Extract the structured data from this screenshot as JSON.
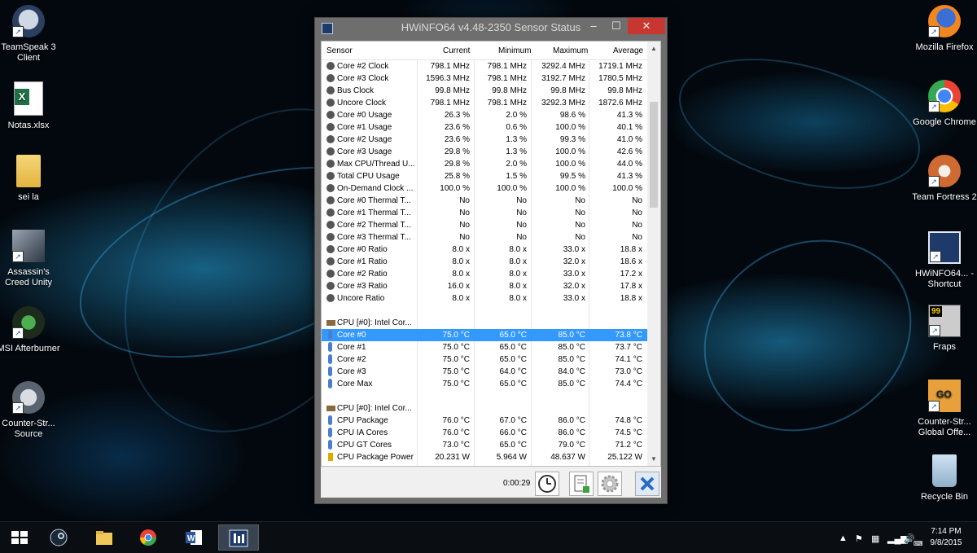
{
  "desktop": {
    "left_icons": [
      {
        "label": "TeamSpeak 3 Client",
        "icon": "teamspeak-icon"
      },
      {
        "label": "Notas.xlsx",
        "icon": "excel-file-icon"
      },
      {
        "label": "sei la",
        "icon": "folder-icon"
      },
      {
        "label": "Assassin's Creed Unity",
        "icon": "assassins-creed-icon"
      },
      {
        "label": "MSI Afterburner",
        "icon": "msi-afterburner-icon"
      },
      {
        "label": "Counter-Str... Source",
        "icon": "counter-strike-source-icon"
      }
    ],
    "right_icons": [
      {
        "label": "Mozilla Firefox",
        "icon": "firefox-icon"
      },
      {
        "label": "Google Chrome",
        "icon": "chrome-icon"
      },
      {
        "label": "Team Fortress 2",
        "icon": "team-fortress-icon"
      },
      {
        "label": "HWiNFO64... - Shortcut",
        "icon": "hwinfo-icon"
      },
      {
        "label": "Fraps",
        "icon": "fraps-icon"
      },
      {
        "label": "Counter-Str... Global Offe...",
        "icon": "csgo-icon"
      },
      {
        "label": "Recycle Bin",
        "icon": "recycle-bin-icon"
      }
    ]
  },
  "window": {
    "title": "HWiNFO64 v4.48-2350 Sensor Status",
    "controls": {
      "minimize": "–",
      "maximize": "☐",
      "close": "✕"
    },
    "columns": {
      "sensor": "Sensor",
      "current": "Current",
      "minimum": "Minimum",
      "maximum": "Maximum",
      "average": "Average"
    },
    "rows": [
      {
        "icon": "gauge",
        "name": "Core #2 Clock",
        "cur": "798.1 MHz",
        "min": "798.1 MHz",
        "max": "3292.4 MHz",
        "avg": "1719.1 MHz"
      },
      {
        "icon": "gauge",
        "name": "Core #3 Clock",
        "cur": "1596.3 MHz",
        "min": "798.1 MHz",
        "max": "3192.7 MHz",
        "avg": "1780.5 MHz"
      },
      {
        "icon": "gauge",
        "name": "Bus Clock",
        "cur": "99.8 MHz",
        "min": "99.8 MHz",
        "max": "99.8 MHz",
        "avg": "99.8 MHz"
      },
      {
        "icon": "gauge",
        "name": "Uncore Clock",
        "cur": "798.1 MHz",
        "min": "798.1 MHz",
        "max": "3292.3 MHz",
        "avg": "1872.6 MHz"
      },
      {
        "icon": "gauge",
        "name": "Core #0 Usage",
        "cur": "26.3 %",
        "min": "2.0 %",
        "max": "98.6 %",
        "avg": "41.3 %"
      },
      {
        "icon": "gauge",
        "name": "Core #1 Usage",
        "cur": "23.6 %",
        "min": "0.6 %",
        "max": "100.0 %",
        "avg": "40.1 %"
      },
      {
        "icon": "gauge",
        "name": "Core #2 Usage",
        "cur": "23.6 %",
        "min": "1.3 %",
        "max": "99.3 %",
        "avg": "41.0 %"
      },
      {
        "icon": "gauge",
        "name": "Core #3 Usage",
        "cur": "29.8 %",
        "min": "1.3 %",
        "max": "100.0 %",
        "avg": "42.6 %"
      },
      {
        "icon": "gauge",
        "name": "Max CPU/Thread U...",
        "cur": "29.8 %",
        "min": "2.0 %",
        "max": "100.0 %",
        "avg": "44.0 %"
      },
      {
        "icon": "gauge",
        "name": "Total CPU Usage",
        "cur": "25.8 %",
        "min": "1.5 %",
        "max": "99.5 %",
        "avg": "41.3 %"
      },
      {
        "icon": "gauge",
        "name": "On-Demand Clock ...",
        "cur": "100.0 %",
        "min": "100.0 %",
        "max": "100.0 %",
        "avg": "100.0 %"
      },
      {
        "icon": "gauge",
        "name": "Core #0 Thermal T...",
        "cur": "No",
        "min": "No",
        "max": "No",
        "avg": "No"
      },
      {
        "icon": "gauge",
        "name": "Core #1 Thermal T...",
        "cur": "No",
        "min": "No",
        "max": "No",
        "avg": "No"
      },
      {
        "icon": "gauge",
        "name": "Core #2 Thermal T...",
        "cur": "No",
        "min": "No",
        "max": "No",
        "avg": "No"
      },
      {
        "icon": "gauge",
        "name": "Core #3 Thermal T...",
        "cur": "No",
        "min": "No",
        "max": "No",
        "avg": "No"
      },
      {
        "icon": "gauge",
        "name": "Core #0 Ratio",
        "cur": "8.0 x",
        "min": "8.0 x",
        "max": "33.0 x",
        "avg": "18.8 x"
      },
      {
        "icon": "gauge",
        "name": "Core #1 Ratio",
        "cur": "8.0 x",
        "min": "8.0 x",
        "max": "32.0 x",
        "avg": "18.6 x"
      },
      {
        "icon": "gauge",
        "name": "Core #2 Ratio",
        "cur": "8.0 x",
        "min": "8.0 x",
        "max": "33.0 x",
        "avg": "17.2 x"
      },
      {
        "icon": "gauge",
        "name": "Core #3 Ratio",
        "cur": "16.0 x",
        "min": "8.0 x",
        "max": "32.0 x",
        "avg": "17.8 x"
      },
      {
        "icon": "gauge",
        "name": "Uncore Ratio",
        "cur": "8.0 x",
        "min": "8.0 x",
        "max": "33.0 x",
        "avg": "18.8 x"
      },
      {
        "icon": "blank",
        "name": "",
        "cur": "",
        "min": "",
        "max": "",
        "avg": ""
      },
      {
        "icon": "chip",
        "name": "CPU [#0]: Intel Cor...",
        "cur": "",
        "min": "",
        "max": "",
        "avg": ""
      },
      {
        "icon": "therm",
        "name": "Core #0",
        "cur": "75.0 °C",
        "min": "65.0 °C",
        "max": "85.0 °C",
        "avg": "73.8 °C",
        "selected": true
      },
      {
        "icon": "therm",
        "name": "Core #1",
        "cur": "75.0 °C",
        "min": "65.0 °C",
        "max": "85.0 °C",
        "avg": "73.7 °C"
      },
      {
        "icon": "therm",
        "name": "Core #2",
        "cur": "75.0 °C",
        "min": "65.0 °C",
        "max": "85.0 °C",
        "avg": "74.1 °C"
      },
      {
        "icon": "therm",
        "name": "Core #3",
        "cur": "75.0 °C",
        "min": "64.0 °C",
        "max": "84.0 °C",
        "avg": "73.0 °C"
      },
      {
        "icon": "therm",
        "name": "Core Max",
        "cur": "75.0 °C",
        "min": "65.0 °C",
        "max": "85.0 °C",
        "avg": "74.4 °C"
      },
      {
        "icon": "blank",
        "name": "",
        "cur": "",
        "min": "",
        "max": "",
        "avg": ""
      },
      {
        "icon": "chip",
        "name": "CPU [#0]: Intel Cor...",
        "cur": "",
        "min": "",
        "max": "",
        "avg": ""
      },
      {
        "icon": "therm",
        "name": "CPU Package",
        "cur": "76.0 °C",
        "min": "67.0 °C",
        "max": "86.0 °C",
        "avg": "74.8 °C"
      },
      {
        "icon": "therm",
        "name": "CPU IA Cores",
        "cur": "76.0 °C",
        "min": "66.0 °C",
        "max": "86.0 °C",
        "avg": "74.5 °C"
      },
      {
        "icon": "therm",
        "name": "CPU GT Cores",
        "cur": "73.0 °C",
        "min": "65.0 °C",
        "max": "79.0 °C",
        "avg": "71.2 °C"
      },
      {
        "icon": "bolt",
        "name": "CPU Package Power",
        "cur": "20.231 W",
        "min": "5.964 W",
        "max": "48.637 W",
        "avg": "25.122 W"
      }
    ],
    "elapsed_time": "0:00:29",
    "buttons": [
      {
        "name": "clock-icon"
      },
      {
        "name": "report-add-icon"
      },
      {
        "name": "settings-gear-icon"
      },
      {
        "name": "close-x-icon"
      }
    ]
  },
  "taskbar": {
    "items": [
      "start-windows-icon",
      "steam-icon",
      "file-explorer-icon",
      "chrome-icon",
      "word-icon",
      "hwinfo-icon"
    ],
    "active_index": 5,
    "tray_icons": [
      "show-hidden-icons-chevron",
      "action-center-flag-icon",
      "network-icon",
      "signal-bars-icon",
      "volume-icon",
      "keyboard-icon"
    ],
    "time": "7:14 PM",
    "date": "9/8/2015"
  },
  "colors": {
    "selection": "#3399ff",
    "close_button": "#c7372f",
    "desktop_glow": "#28aae6"
  }
}
